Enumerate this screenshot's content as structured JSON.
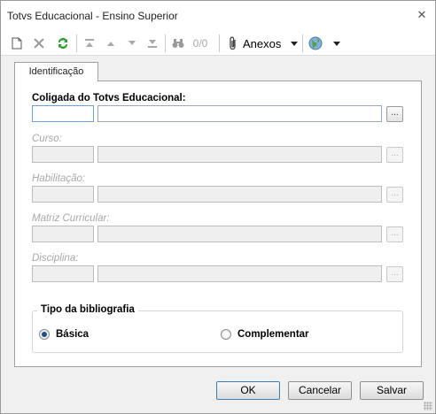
{
  "window": {
    "title": "Totvs Educacional - Ensino Superior",
    "close_glyph": "✕"
  },
  "toolbar": {
    "items": [
      {
        "name": "new-record-icon",
        "enabled": true
      },
      {
        "name": "delete-record-icon",
        "enabled": false
      },
      {
        "name": "refresh-icon",
        "enabled": true
      },
      {
        "name": "first-record-icon",
        "enabled": false
      },
      {
        "name": "previous-record-icon",
        "enabled": false
      },
      {
        "name": "next-record-icon",
        "enabled": false
      },
      {
        "name": "last-record-icon",
        "enabled": false
      },
      {
        "name": "binoculars-icon",
        "enabled": false
      }
    ],
    "record_counter": "0/0",
    "attachments_label": "Anexos",
    "attachments_icon": "paperclip-icon",
    "globe_icon": "globe-icon"
  },
  "tabs": [
    {
      "label": "Identificação",
      "active": true
    }
  ],
  "form": {
    "fields": [
      {
        "label": "Coligada do Totvs Educacional:",
        "code": "",
        "description": "",
        "enabled": true,
        "lookup": "..."
      },
      {
        "label": "Curso:",
        "code": "",
        "description": "",
        "enabled": false,
        "lookup": "..."
      },
      {
        "label": "Habilitação:",
        "code": "",
        "description": "",
        "enabled": false,
        "lookup": "..."
      },
      {
        "label": "Matriz Curricular:",
        "code": "",
        "description": "",
        "enabled": false,
        "lookup": "..."
      },
      {
        "label": "Disciplina:",
        "code": "",
        "description": "",
        "enabled": false,
        "lookup": "..."
      }
    ],
    "bibliography": {
      "legend": "Tipo da bibliografia",
      "options": [
        {
          "label": "Básica",
          "checked": true
        },
        {
          "label": "Complementar",
          "checked": false
        }
      ]
    }
  },
  "buttons": {
    "ok": "OK",
    "cancel": "Cancelar",
    "save": "Salvar"
  },
  "colors": {
    "refresh_green": "#2e9b2e",
    "radio_selected": "#1f4f8a",
    "focus_border": "#6f9fd8"
  }
}
